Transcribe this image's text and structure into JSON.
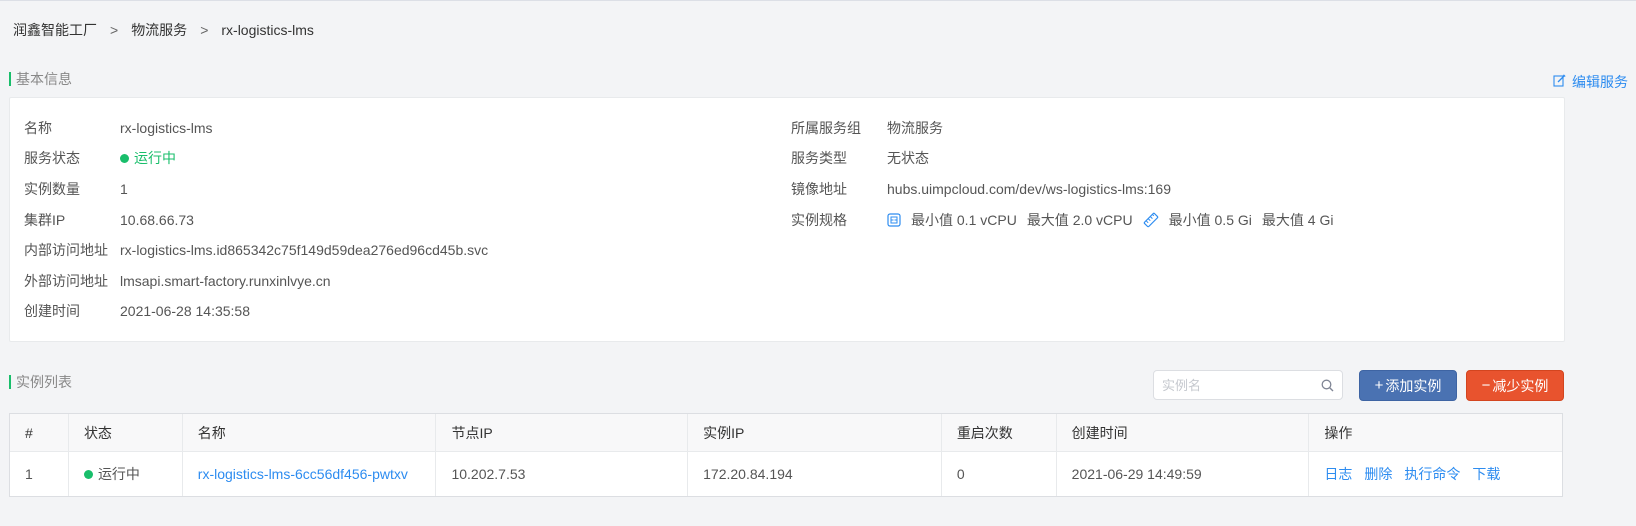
{
  "breadcrumb": {
    "items": [
      "润鑫智能工厂",
      "物流服务",
      "rx-logistics-lms"
    ],
    "separator": ">"
  },
  "basic_info": {
    "section_title": "基本信息",
    "edit_label": "编辑服务",
    "left": [
      {
        "label": "名称",
        "value": "rx-logistics-lms"
      },
      {
        "label": "服务状态",
        "value": "运行中"
      },
      {
        "label": "实例数量",
        "value": "1"
      },
      {
        "label": "集群IP",
        "value": "10.68.66.73"
      },
      {
        "label": "内部访问地址",
        "value": "rx-logistics-lms.id865342c75f149d59dea276ed96cd45b.svc"
      },
      {
        "label": "外部访问地址",
        "value": "lmsapi.smart-factory.runxinlvye.cn"
      },
      {
        "label": "创建时间",
        "value": "2021-06-28 14:35:58"
      }
    ],
    "right": [
      {
        "label": "所属服务组",
        "value": "物流服务"
      },
      {
        "label": "服务类型",
        "value": "无状态"
      },
      {
        "label": "镜像地址",
        "value": "hubs.uimpcloud.com/dev/ws-logistics-lms:169"
      },
      {
        "label": "实例规格"
      }
    ],
    "spec": {
      "cpu_min": "最小值 0.1 vCPU",
      "cpu_max": "最大值 2.0 vCPU",
      "mem_min": "最小值 0.5 Gi",
      "mem_max": "最大值 4 Gi"
    }
  },
  "instance_list": {
    "section_title": "实例列表",
    "search_placeholder": "实例名",
    "add_button": "添加实例",
    "add_symbol": "+",
    "reduce_button": "减少实例",
    "reduce_symbol": "−",
    "columns": [
      "#",
      "状态",
      "名称",
      "节点IP",
      "实例IP",
      "重启次数",
      "创建时间",
      "操作"
    ],
    "rows": [
      {
        "index": "1",
        "status": "运行中",
        "name": "rx-logistics-lms-6cc56df456-pwtxv",
        "node_ip": "10.202.7.53",
        "instance_ip": "172.20.84.194",
        "restarts": "0",
        "created": "2021-06-29 14:49:59",
        "ops": [
          "日志",
          "删除",
          "执行命令",
          "下载"
        ]
      }
    ]
  },
  "colors": {
    "accent": "#2d8cf0",
    "running": "#19be6b",
    "add_button": "#4a72b2",
    "reduce_button": "#e8532e"
  },
  "icons": {
    "edit": "edit-icon",
    "search": "search-icon",
    "cpu": "cpu-icon",
    "memory": "memory-icon"
  }
}
